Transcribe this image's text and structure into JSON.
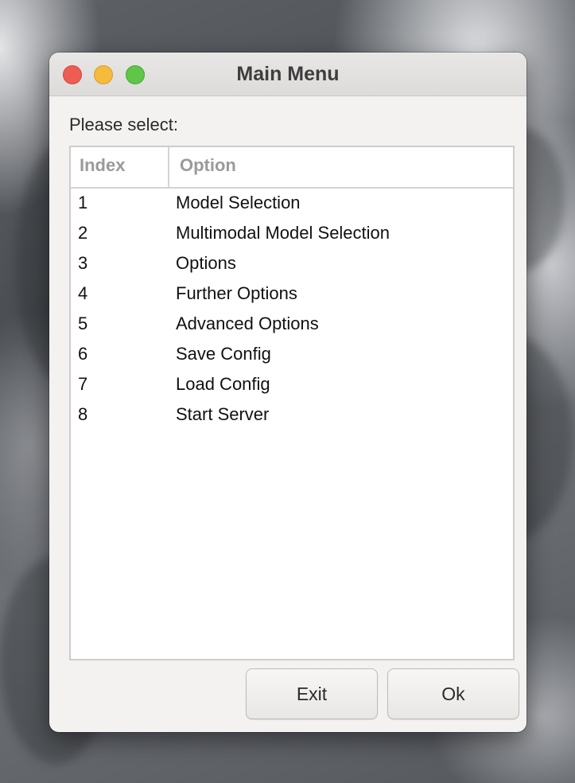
{
  "window": {
    "title": "Main Menu",
    "traffic_lights": {
      "close_color": "#ee5d54",
      "minimize_color": "#f4bb3e",
      "maximize_color": "#5fc64a"
    }
  },
  "prompt_label": "Please select:",
  "table": {
    "columns": [
      "Index",
      "Option"
    ],
    "rows": [
      {
        "index": "1",
        "option": "Model Selection"
      },
      {
        "index": "2",
        "option": "Multimodal Model Selection"
      },
      {
        "index": "3",
        "option": "Options"
      },
      {
        "index": "4",
        "option": "Further Options"
      },
      {
        "index": "5",
        "option": "Advanced Options"
      },
      {
        "index": "6",
        "option": "Save Config"
      },
      {
        "index": "7",
        "option": "Load Config"
      },
      {
        "index": "8",
        "option": "Start Server"
      }
    ]
  },
  "buttons": {
    "exit_label": "Exit",
    "ok_label": "Ok"
  }
}
